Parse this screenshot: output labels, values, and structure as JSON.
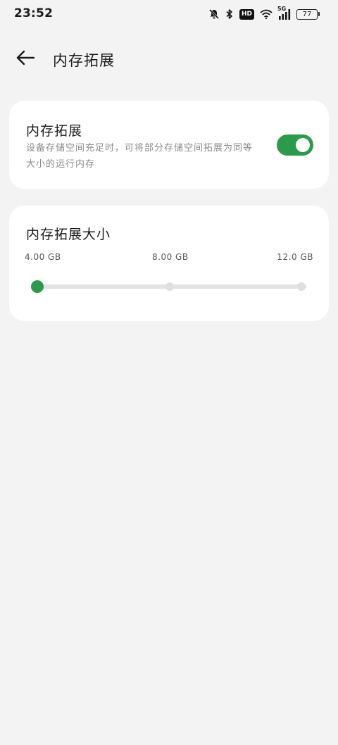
{
  "status_bar": {
    "time": "23:52",
    "hd_label": "HD",
    "network_label": "5G",
    "battery_level": "77",
    "icons": [
      "bell-off-icon",
      "bluetooth-icon",
      "hd-icon",
      "wifi-icon",
      "signal-icon",
      "battery-icon"
    ]
  },
  "app_bar": {
    "back_icon": "arrow-left-icon",
    "title": "内存拓展"
  },
  "memory_expansion": {
    "title": "内存拓展",
    "description": "设备存储空间充足时，可将部分存储空间拓展为同等大小的运行内存",
    "enabled": true
  },
  "expansion_size": {
    "title": "内存拓展大小",
    "options": [
      "4.00 GB",
      "8.00 GB",
      "12.0 GB"
    ],
    "selected_index": 0
  },
  "colors": {
    "accent": "#2b9a4a",
    "background": "#f3f3f3",
    "card": "#ffffff",
    "track": "#e2e2e2"
  }
}
